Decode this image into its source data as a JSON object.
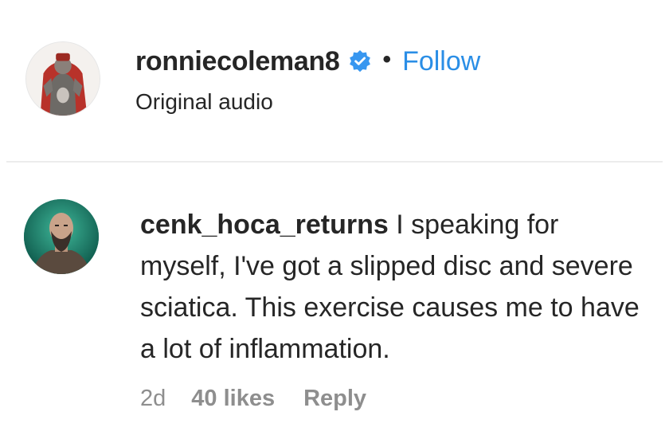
{
  "post": {
    "username": "ronniecoleman8",
    "verified_icon": "verified-badge-icon",
    "separator": "•",
    "follow_label": "Follow",
    "audio_label": "Original audio",
    "avatar_icon": "profile-avatar"
  },
  "comment": {
    "username": "cenk_hoca_returns",
    "text": "I speaking for myself, I've got a slipped disc and severe sciatica. This exercise causes me to have a lot of inflammation.",
    "time": "2d",
    "likes": "40 likes",
    "reply_label": "Reply",
    "avatar_icon": "commenter-avatar"
  },
  "colors": {
    "text": "#262626",
    "secondary": "#8e8e8e",
    "link_blue": "#2a8ee6",
    "verified_blue": "#3897f0",
    "divider": "#ececec"
  }
}
